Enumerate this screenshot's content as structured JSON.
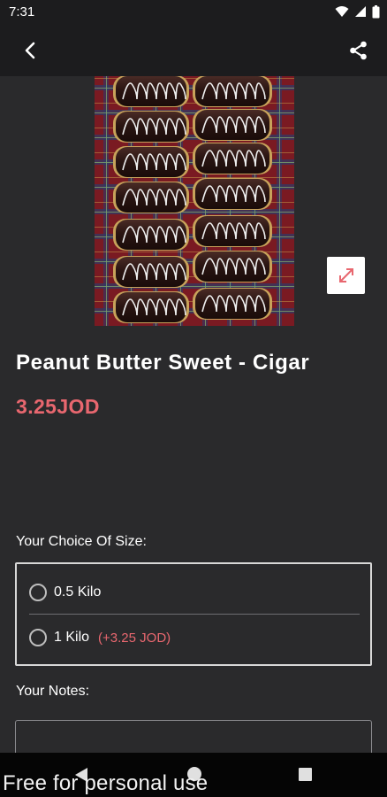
{
  "status_bar": {
    "time": "7:31"
  },
  "app_bar": {
    "back_icon": "chevron-left-icon",
    "share_icon": "share-icon"
  },
  "product": {
    "image_icon": "product-photo",
    "expand_icon": "expand-icon",
    "title": "Peanut Butter Sweet - Cigar",
    "price": "3.25JOD"
  },
  "size_section": {
    "label": "Your Choice Of Size:",
    "options": [
      {
        "label": "0.5 Kilo",
        "extra": "",
        "selected": false
      },
      {
        "label": "1 Kilo",
        "extra": "(+3.25 JOD)",
        "selected": false
      }
    ]
  },
  "notes_section": {
    "label": "Your Notes:",
    "value": ""
  },
  "watermark": "Free for personal use",
  "colors": {
    "accent": "#e8676f",
    "background": "#2a2a2c",
    "app_bar": "#1c1c1e"
  }
}
